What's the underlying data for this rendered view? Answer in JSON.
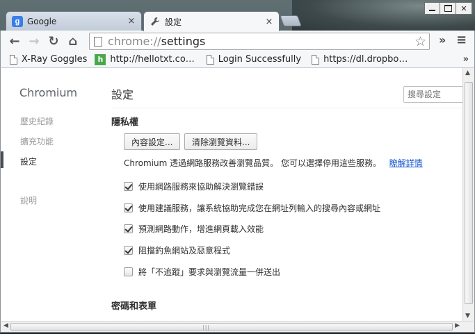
{
  "window": {
    "minimize_label": "",
    "maximize_label": "",
    "close_label": "✕"
  },
  "tabs": [
    {
      "title": "Google",
      "favicon": "google-icon",
      "close": "×"
    },
    {
      "title": "設定",
      "favicon": "wrench-icon",
      "close": "×"
    }
  ],
  "toolbar": {
    "back": "←",
    "forward": "→",
    "reload": "↻",
    "home": "⌂",
    "url_scheme": "chrome://",
    "url_host": "settings",
    "star": "☆",
    "extensions": "»",
    "menu": "≡"
  },
  "bookmarks": {
    "items": [
      {
        "label": "X-Ray Goggles",
        "icon": "page-icon"
      },
      {
        "label": "http://hellotxt.co…",
        "icon": "hellotxt-icon"
      },
      {
        "label": "Login Successfully",
        "icon": "page-icon"
      },
      {
        "label": "https://dl.dropbo…",
        "icon": "page-icon"
      }
    ],
    "overflow": "»"
  },
  "sidebar": {
    "brand": "Chromium",
    "items": [
      {
        "label": "歷史紀錄",
        "selected": false
      },
      {
        "label": "擴充功能",
        "selected": false
      },
      {
        "label": "設定",
        "selected": true
      },
      {
        "label": "說明",
        "selected": false
      }
    ]
  },
  "main": {
    "title": "設定",
    "search_placeholder": "搜尋設定",
    "privacy": {
      "heading": "隱私權",
      "content_settings_button": "內容設定...",
      "clear_data_button": "清除瀏覽資料...",
      "description": "Chromium 透過網路服務改善瀏覽品質。 您可以選擇停用這些服務。",
      "learn_more": "瞭解詳情",
      "checkboxes": [
        {
          "label": "使用網路服務來協助解決瀏覽錯誤",
          "checked": true
        },
        {
          "label": "使用建議服務，讓系統協助完成您在網址列輸入的搜尋內容或網址",
          "checked": true
        },
        {
          "label": "預測網路動作，增進網頁載入效能",
          "checked": true
        },
        {
          "label": "阻擋釣魚網站及惡意程式",
          "checked": true
        },
        {
          "label": "將「不追蹤」要求與瀏覽流量一併送出",
          "checked": false
        }
      ]
    },
    "passwords_heading": "密碼和表單"
  },
  "scrollbars": {
    "up": "▲",
    "down": "▼",
    "left": "◀",
    "right": "▶",
    "grip": "|||"
  }
}
